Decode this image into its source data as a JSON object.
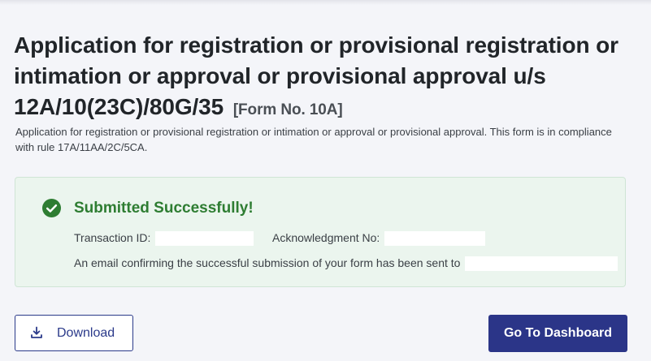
{
  "header": {
    "title": "Application for registration or provisional registration or intimation or approval or provisional approval u/s 12A/10(23C)/80G/35",
    "form_no": "[Form No. 10A]",
    "description": "Application for registration or provisional registration or intimation or approval or provisional approval. This form is in compliance with rule 17A/11AA/2C/5CA."
  },
  "success": {
    "title": "Submitted Successfully!",
    "transaction_label": "Transaction ID:",
    "transaction_value": "",
    "ack_label": "Acknowledgment No:",
    "ack_value": "",
    "email_text": "An email confirming the successful submission of your form has been sent to",
    "email_value": "",
    "accent_color": "#2e7d32"
  },
  "actions": {
    "download_label": "Download",
    "dashboard_label": "Go To Dashboard",
    "primary_color": "#2b3588"
  },
  "icons": {
    "success": "check-circle-icon",
    "download": "download-icon"
  }
}
